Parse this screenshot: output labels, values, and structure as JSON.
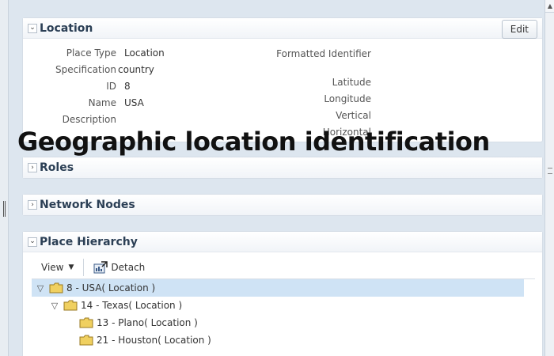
{
  "overlay": {
    "title": "Geographic location identification"
  },
  "location_panel": {
    "title": "Location",
    "edit_label": "Edit",
    "left_fields": [
      {
        "label": "Place Type",
        "value": "Location"
      },
      {
        "label": "Specification",
        "value": "country"
      },
      {
        "label": "ID",
        "value": "8"
      },
      {
        "label": "Name",
        "value": "USA"
      },
      {
        "label": "Description",
        "value": ""
      }
    ],
    "right_fields": [
      {
        "label": "Formatted Identifier",
        "value": ""
      },
      {
        "label": "Latitude",
        "value": ""
      },
      {
        "label": "Longitude",
        "value": ""
      },
      {
        "label": "Vertical",
        "value": ""
      },
      {
        "label": "Horizontal",
        "value": ""
      }
    ]
  },
  "roles_panel": {
    "title": "Roles"
  },
  "network_panel": {
    "title": "Network Nodes"
  },
  "hierarchy_panel": {
    "title": "Place Hierarchy",
    "view_label": "View",
    "detach_label": "Detach",
    "tree": [
      {
        "label": "8 - USA( Location )",
        "level": 0,
        "expanded": true,
        "selected": true
      },
      {
        "label": "14 - Texas( Location )",
        "level": 1,
        "expanded": true,
        "selected": false
      },
      {
        "label": "13 - Plano( Location )",
        "level": 2,
        "expanded": false,
        "selected": false
      },
      {
        "label": "21 - Houston( Location )",
        "level": 2,
        "expanded": false,
        "selected": false
      }
    ]
  },
  "colors": {
    "selected_row": "#cfe3f5",
    "panel_title": "#2b3f55",
    "folder": "#f0d060"
  }
}
